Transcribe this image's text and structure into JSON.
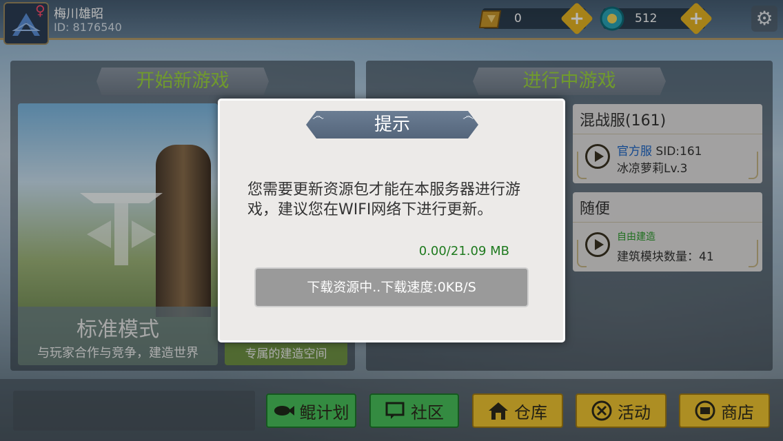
{
  "profile": {
    "name": "梅川雄昭",
    "id_text": "ID: 8176540",
    "gender_symbol": "♀"
  },
  "currency": {
    "gems": "0",
    "coins": "512",
    "add_symbol": "+"
  },
  "settings_icon": "⚙",
  "panels": {
    "new_game_title": "开始新游戏",
    "ongoing_title": "进行中游戏"
  },
  "mode_card": {
    "title": "标准模式",
    "subtitle": "与玩家合作与竞争，建造世界",
    "second_subtitle": "专属的建造空间"
  },
  "servers": [
    {
      "name": "混战服(161)",
      "tag": "官方服",
      "detail": "SID:161",
      "line2": "冰凉萝莉Lv.3"
    },
    {
      "name": "随便",
      "tag": "自由建造",
      "line2": "建筑模块数量：41"
    }
  ],
  "nav": {
    "plan": "鲲计划",
    "community": "社区",
    "storage": "仓库",
    "events": "活动",
    "shop": "商店"
  },
  "dialog": {
    "title": "提示",
    "message": "您需要更新资源包才能在本服务器进行游戏，建议您在WIFI网络下进行更新。",
    "progress": "0.00/21.09 MB",
    "status": "下载资源中..下载速度:0KB/S"
  },
  "colors": {
    "banner_text_green": "#9cd63f",
    "nav_green": "#49c15a",
    "nav_yellow": "#f0c531",
    "progress_green": "#1e7a1e",
    "official_tag_blue": "#1c66c6"
  }
}
